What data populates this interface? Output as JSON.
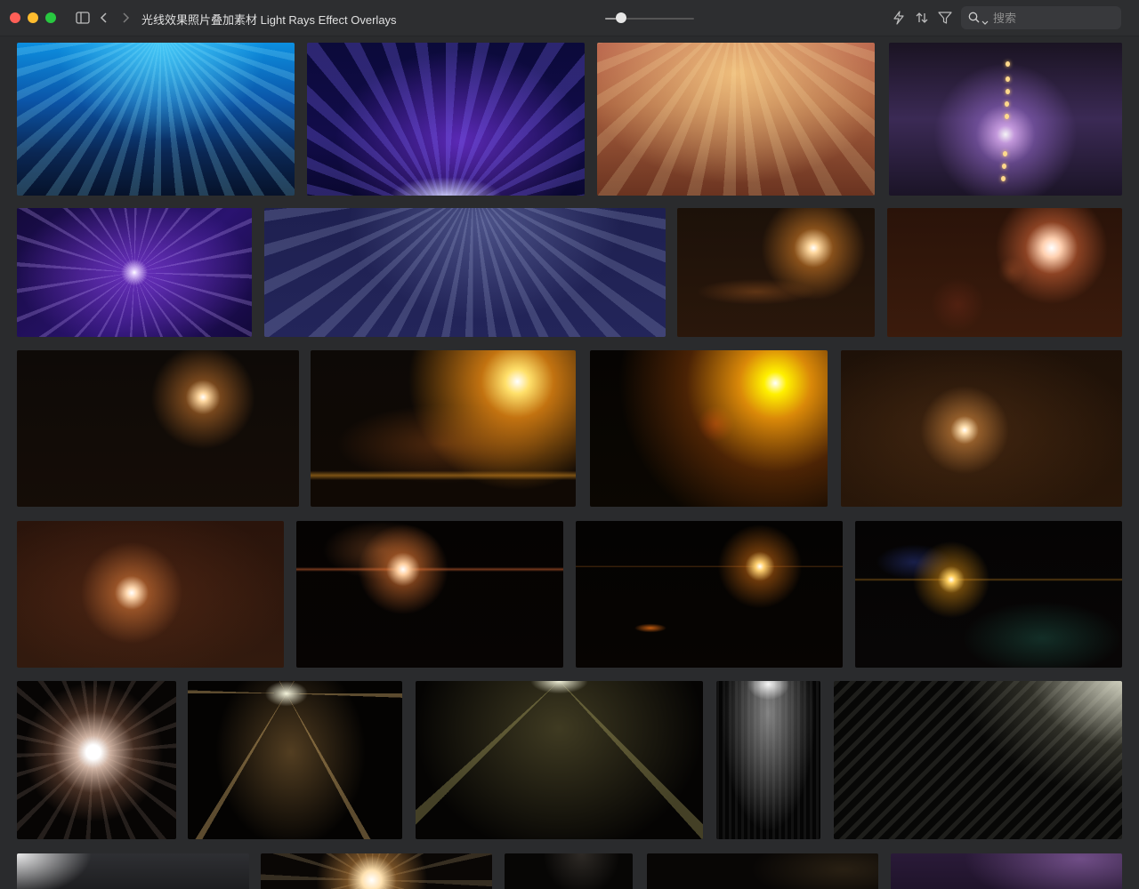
{
  "window": {
    "title": "光线效果照片叠加素材 Light Rays Effect Overlays"
  },
  "toolbar": {
    "thumbnail_size": 0.18,
    "search_placeholder": "搜索",
    "icons": [
      "sidebar-toggle-icon",
      "back-chevron-icon",
      "forward-chevron-icon",
      "lightning-icon",
      "sort-icon",
      "filter-icon",
      "search-icon"
    ]
  },
  "colors": {
    "close": "#fe5f57",
    "minimize": "#febc2e",
    "zoom": "#28c840",
    "background": "#2a2b2d"
  },
  "grid": {
    "items": [
      {
        "name": "blue-rays"
      },
      {
        "name": "purple-blue-rays"
      },
      {
        "name": "warm-rays"
      },
      {
        "name": "violet-flare-beads"
      },
      {
        "name": "violet-star-burst"
      },
      {
        "name": "navy-stage-rays"
      },
      {
        "name": "orange-flare-small"
      },
      {
        "name": "orange-bokeh-flare"
      },
      {
        "name": "dark-amber-flare"
      },
      {
        "name": "golden-sun-flare"
      },
      {
        "name": "yellow-sun-flare"
      },
      {
        "name": "brown-star-flare"
      },
      {
        "name": "copper-star-flare"
      },
      {
        "name": "orange-streak-flare"
      },
      {
        "name": "amber-horizon-flare"
      },
      {
        "name": "rainbow-anamorphic-flare"
      },
      {
        "name": "white-sparkle-flare"
      },
      {
        "name": "gold-spotlight-cone"
      },
      {
        "name": "olive-spotlight-fan"
      },
      {
        "name": "white-spotlight"
      },
      {
        "name": "diagonal-white-rays"
      },
      {
        "name": "corner-white-glow"
      },
      {
        "name": "warm-sparkle-partial"
      },
      {
        "name": "dark-partial"
      },
      {
        "name": "brown-partial"
      },
      {
        "name": "violet-partial"
      }
    ]
  }
}
